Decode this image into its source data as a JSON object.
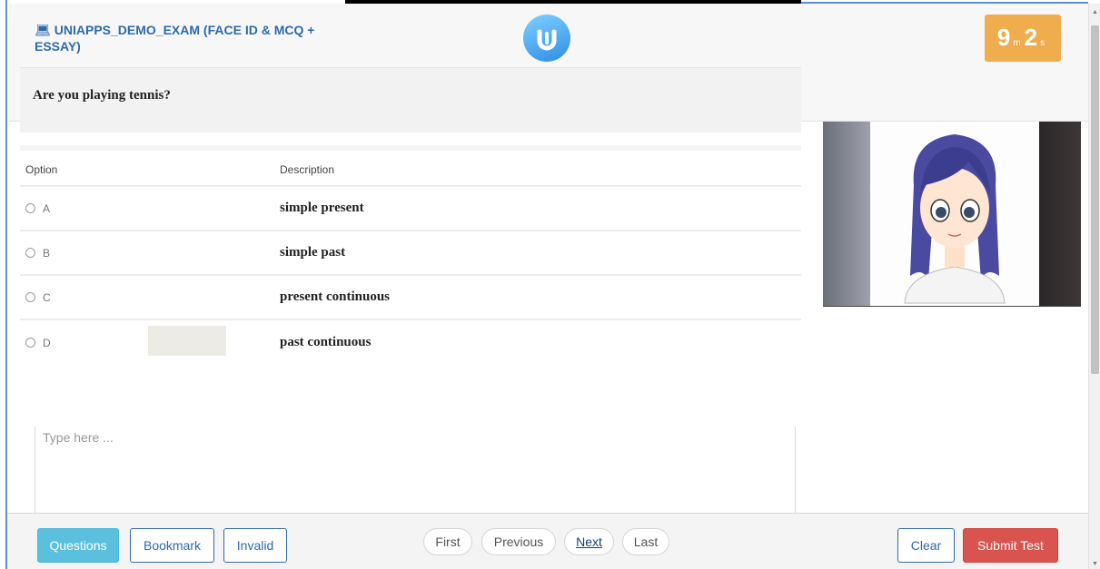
{
  "header": {
    "laptop_icon": "laptop-icon",
    "title": "UNIAPPS_DEMO_EXAM (FACE ID & MCQ + ESSAY)",
    "logo_icon": "uniapps-logo",
    "timer": {
      "minutes": "9",
      "minutes_unit": "m",
      "seconds": "2",
      "seconds_unit": "s"
    }
  },
  "question": {
    "text": "Are you playing tennis?"
  },
  "options": {
    "header_option": "Option",
    "header_description": "Description",
    "rows": [
      {
        "label": "A",
        "description": "simple present"
      },
      {
        "label": "B",
        "description": "simple past"
      },
      {
        "label": "C",
        "description": "present continuous"
      },
      {
        "label": "D",
        "description": "past continuous"
      }
    ]
  },
  "essay": {
    "placeholder": "Type here ..."
  },
  "footer": {
    "questions": "Questions",
    "bookmark": "Bookmark",
    "invalid": "Invalid",
    "first": "First",
    "previous": "Previous",
    "next": "Next",
    "last": "Last",
    "clear": "Clear",
    "submit": "Submit Test"
  },
  "colors": {
    "accent": "#2e6aab",
    "timer": "#f0ad4e",
    "questions_button": "#5bc0de",
    "submit_button": "#d9534f"
  }
}
